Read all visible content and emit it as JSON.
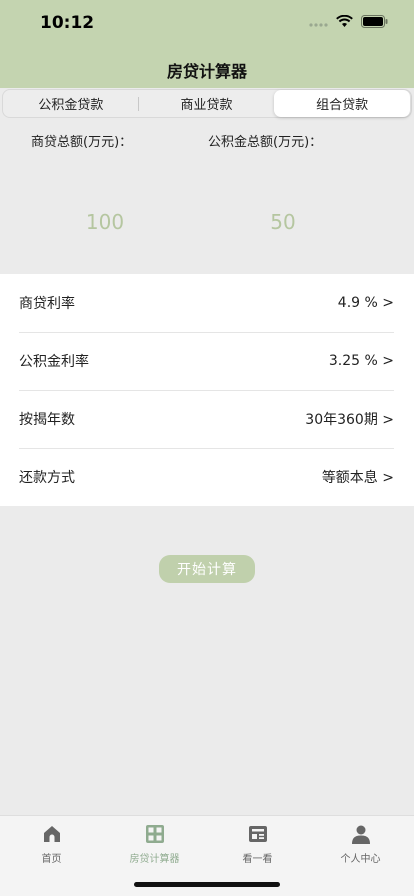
{
  "status": {
    "time": "10:12"
  },
  "nav": {
    "title": "房贷计算器"
  },
  "segments": {
    "provident": "公积金贷款",
    "commercial": "商业贷款",
    "combined": "组合贷款",
    "selected": "组合贷款"
  },
  "amounts": {
    "commercial_label": "商贷总额(万元)：",
    "commercial_value": "100",
    "provident_label": "公积金总额(万元)：",
    "provident_value": "50"
  },
  "settings": {
    "commercial_rate": {
      "label": "商贷利率",
      "value": "4.9 % >"
    },
    "provident_rate": {
      "label": "公积金利率",
      "value": "3.25 % >"
    },
    "term": {
      "label": "按揭年数",
      "value": "30年360期 >"
    },
    "method": {
      "label": "还款方式",
      "value": "等额本息 >"
    }
  },
  "actions": {
    "calculate": "开始计算"
  },
  "tabbar": {
    "home": "首页",
    "calculator": "房贷计算器",
    "browse": "看一看",
    "profile": "个人中心",
    "active": "calculator"
  },
  "colors": {
    "header_bg": "#c4d4b0",
    "accent_text": "#b5c6a0",
    "button_bg": "#c0d0ac",
    "tab_active": "#8fab8f"
  }
}
